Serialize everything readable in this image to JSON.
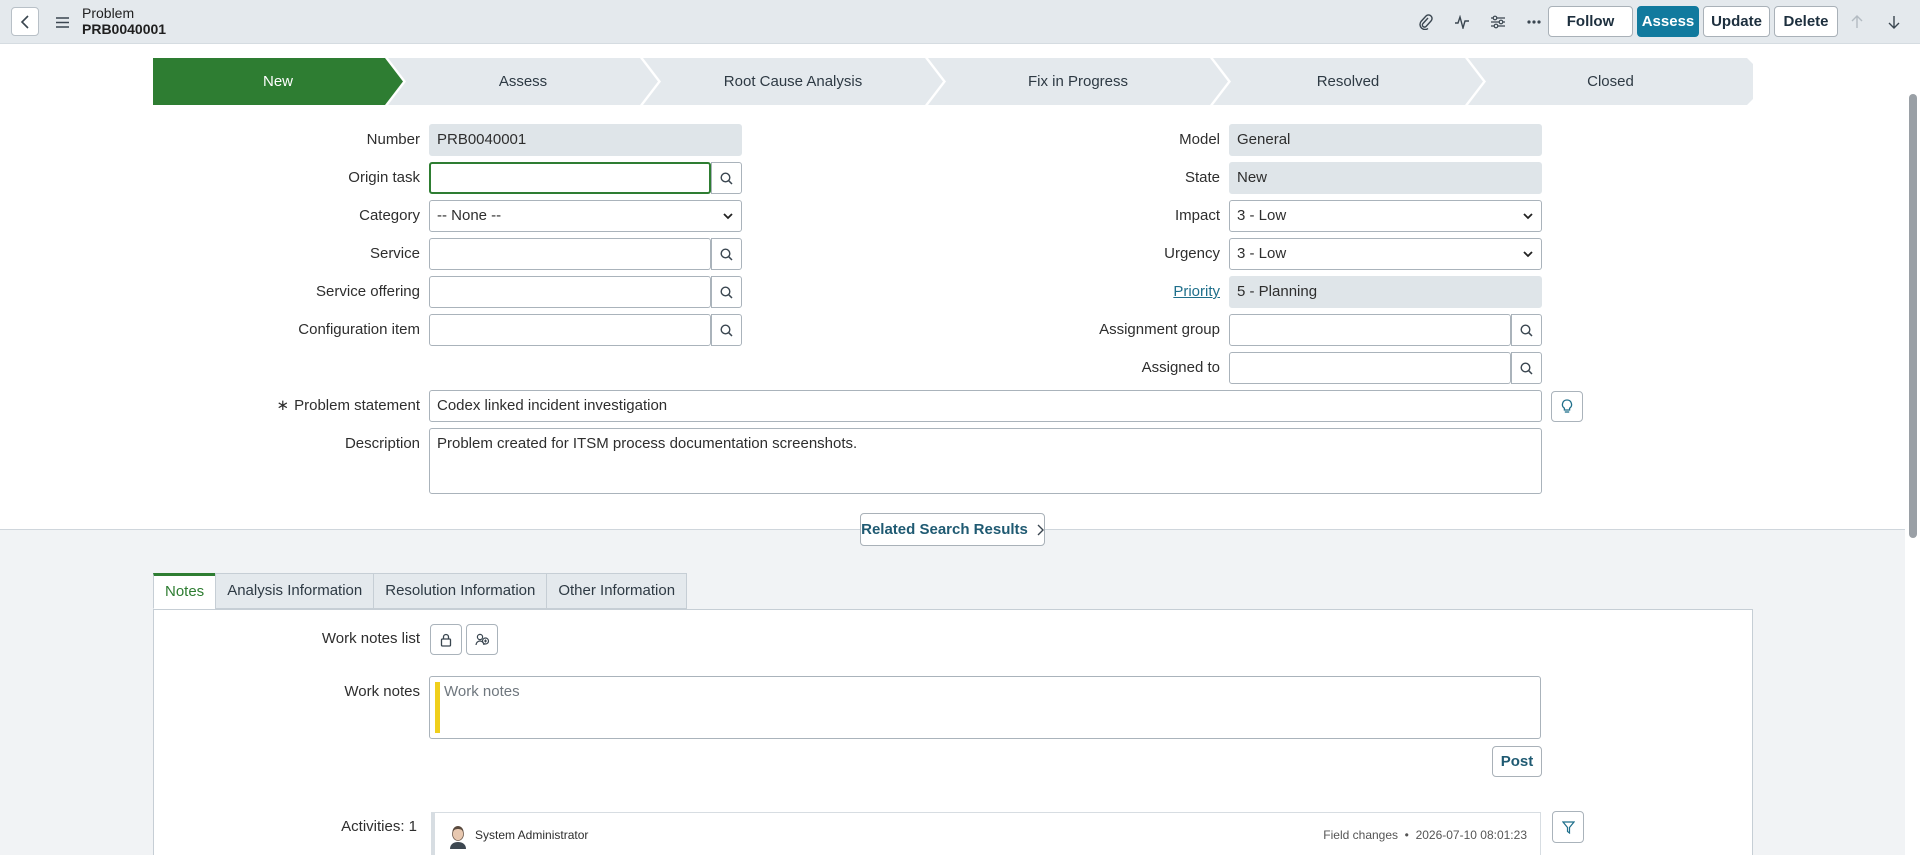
{
  "header": {
    "title": "Problem",
    "number": "PRB0040001",
    "buttons": {
      "follow": "Follow",
      "assess": "Assess",
      "update": "Update",
      "delete": "Delete"
    }
  },
  "colors": {
    "accent": "#117a9e",
    "active_stage": "#2e7d32",
    "worknote_bar": "#f0cf1c"
  },
  "process_flow": [
    "New",
    "Assess",
    "Root Cause Analysis",
    "Fix in Progress",
    "Resolved",
    "Closed"
  ],
  "form": {
    "number": {
      "label": "Number",
      "value": "PRB0040001"
    },
    "origin_task": {
      "label": "Origin task",
      "value": ""
    },
    "category": {
      "label": "Category",
      "value": "-- None --"
    },
    "service": {
      "label": "Service",
      "value": ""
    },
    "service_offering": {
      "label": "Service offering",
      "value": ""
    },
    "configuration_item": {
      "label": "Configuration item",
      "value": ""
    },
    "model": {
      "label": "Model",
      "value": "General"
    },
    "state": {
      "label": "State",
      "value": "New"
    },
    "impact": {
      "label": "Impact",
      "value": "3 - Low"
    },
    "urgency": {
      "label": "Urgency",
      "value": "3 - Low"
    },
    "priority": {
      "label": "Priority",
      "value": "5 - Planning"
    },
    "assignment_group": {
      "label": "Assignment group",
      "value": ""
    },
    "assigned_to": {
      "label": "Assigned to",
      "value": ""
    },
    "problem_statement": {
      "label": "Problem statement",
      "mandatory_mark": "∗",
      "value": "Codex linked incident investigation"
    },
    "description": {
      "label": "Description",
      "value": "Problem created for ITSM process documentation screenshots."
    }
  },
  "related_search": "Related Search Results",
  "tabs": [
    "Notes",
    "Analysis Information",
    "Resolution Information",
    "Other Information"
  ],
  "notes": {
    "work_notes_list_label": "Work notes list",
    "work_notes_label": "Work notes",
    "work_notes_placeholder": "Work notes",
    "post_label": "Post",
    "activities_label": "Activities: 1",
    "activity": {
      "author": "System Administrator",
      "type": "Field changes",
      "timestamp": "2026-07-10 08:01:23"
    }
  },
  "icons": [
    "chevron-left-icon",
    "hamburger-icon",
    "paperclip-icon",
    "pulse-icon",
    "sliders-icon",
    "more-icon",
    "arrow-up-icon",
    "arrow-down-icon",
    "search-icon",
    "lightbulb-icon",
    "lock-icon",
    "people-icon",
    "filter-icon",
    "chevron-right-icon"
  ]
}
